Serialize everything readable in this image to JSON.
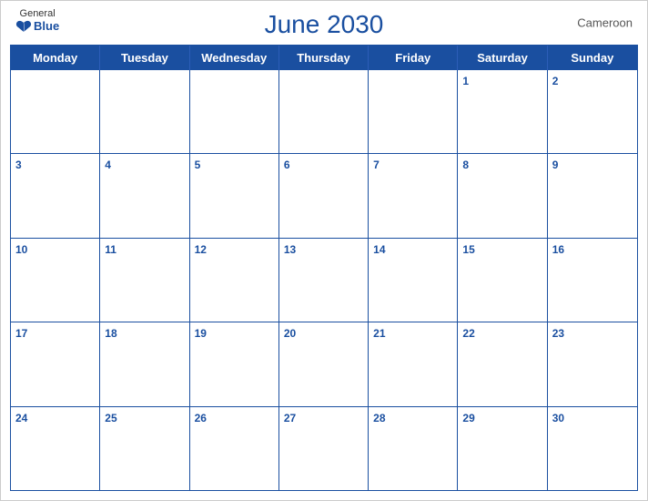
{
  "header": {
    "title": "June 2030",
    "country": "Cameroon",
    "logo": {
      "general": "General",
      "blue": "Blue"
    }
  },
  "calendar": {
    "day_headers": [
      "Monday",
      "Tuesday",
      "Wednesday",
      "Thursday",
      "Friday",
      "Saturday",
      "Sunday"
    ],
    "weeks": [
      [
        {
          "day": "",
          "empty": true
        },
        {
          "day": "",
          "empty": true
        },
        {
          "day": "",
          "empty": true
        },
        {
          "day": "",
          "empty": true
        },
        {
          "day": "",
          "empty": true
        },
        {
          "day": "1"
        },
        {
          "day": "2"
        }
      ],
      [
        {
          "day": "3"
        },
        {
          "day": "4"
        },
        {
          "day": "5"
        },
        {
          "day": "6"
        },
        {
          "day": "7"
        },
        {
          "day": "8"
        },
        {
          "day": "9"
        }
      ],
      [
        {
          "day": "10"
        },
        {
          "day": "11"
        },
        {
          "day": "12"
        },
        {
          "day": "13"
        },
        {
          "day": "14"
        },
        {
          "day": "15"
        },
        {
          "day": "16"
        }
      ],
      [
        {
          "day": "17"
        },
        {
          "day": "18"
        },
        {
          "day": "19"
        },
        {
          "day": "20"
        },
        {
          "day": "21"
        },
        {
          "day": "22"
        },
        {
          "day": "23"
        }
      ],
      [
        {
          "day": "24"
        },
        {
          "day": "25"
        },
        {
          "day": "26"
        },
        {
          "day": "27"
        },
        {
          "day": "28"
        },
        {
          "day": "29"
        },
        {
          "day": "30"
        }
      ]
    ]
  }
}
